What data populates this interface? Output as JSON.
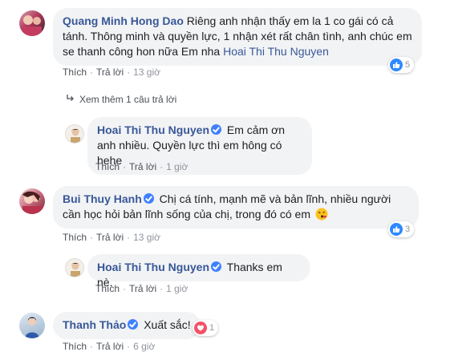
{
  "comments": [
    {
      "name": "Quang Minh Hong Dao",
      "text": "Riêng anh nhận thấy em la 1 co gái có cả tánh. Thông minh và quyền lực, 1 nhận xét rất chân tình, anh chúc em se thanh công hon nữa Em nha",
      "tag": "Hoai Thi Thu Nguyen",
      "like": "Thích",
      "reply": "Trả lời",
      "time": "13 giờ",
      "reaction_count": "5"
    },
    {
      "more_replies": "Xem thêm 1 câu trả lời"
    },
    {
      "name": "Hoai Thi Thu Nguyen",
      "text": "Em cảm ơn anh nhiều. Quyền lực thì em hông có hehe",
      "like": "Thích",
      "reply": "Trả lời",
      "time": "1 giờ"
    },
    {
      "name": "Bui Thuy Hanh",
      "text": "Chị cá tính, mạnh mẽ và bản lĩnh, nhiều người cần học hỏi bản lĩnh sống của chị, trong đó có em",
      "like": "Thích",
      "reply": "Trả lời",
      "time": "13 giờ",
      "reaction_count": "3"
    },
    {
      "name": "Hoai Thi Thu Nguyen",
      "text": "Thanks em nè.",
      "like": "Thích",
      "reply": "Trả lời",
      "time": "1 giờ"
    },
    {
      "name": "Thanh Thảo",
      "text": "Xuất sắc!",
      "like": "Thích",
      "reply": "Trả lời",
      "time": "6 giờ",
      "reaction_count": "1"
    }
  ],
  "colors": {
    "bubble": "#f2f3f5",
    "name": "#385898",
    "meta": "#90949c",
    "like_blue": "#2e89ff",
    "heart_red": "#f25268"
  }
}
